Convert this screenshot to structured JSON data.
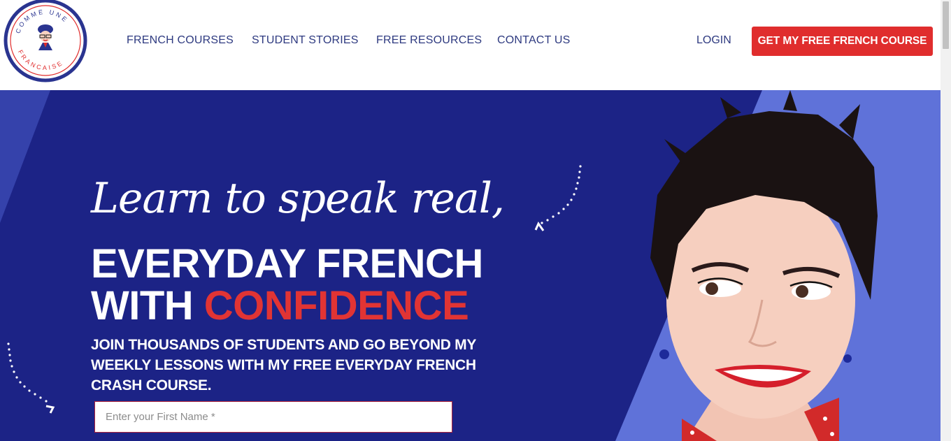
{
  "brand": {
    "logo_text": "COMME UNE FRANÇAISE",
    "colors": {
      "navy": "#1c2386",
      "red": "#e02d2d",
      "light_blue": "#5f72d9",
      "nav_text": "#2e3a80"
    }
  },
  "nav": {
    "items": [
      {
        "label": "FRENCH COURSES"
      },
      {
        "label": "STUDENT STORIES"
      },
      {
        "label": "FREE RESOURCES"
      },
      {
        "label": "CONTACT US"
      }
    ],
    "login": "LOGIN",
    "cta": "GET MY FREE FRENCH COURSE"
  },
  "hero": {
    "script_line": "Learn to speak real,",
    "headline_line1": "EVERYDAY FRENCH",
    "headline_line2_a": "WITH ",
    "headline_line2_b": "CONFIDENCE",
    "subheading": "JOIN THOUSANDS OF STUDENTS AND GO BEYOND MY WEEKLY LESSONS WITH MY FREE EVERYDAY FRENCH CRASH COURSE.",
    "first_name_placeholder": "Enter your First Name *",
    "first_name_value": ""
  },
  "icons": [
    "logo-icon",
    "dotted-arrow-icon",
    "scrollbar"
  ]
}
